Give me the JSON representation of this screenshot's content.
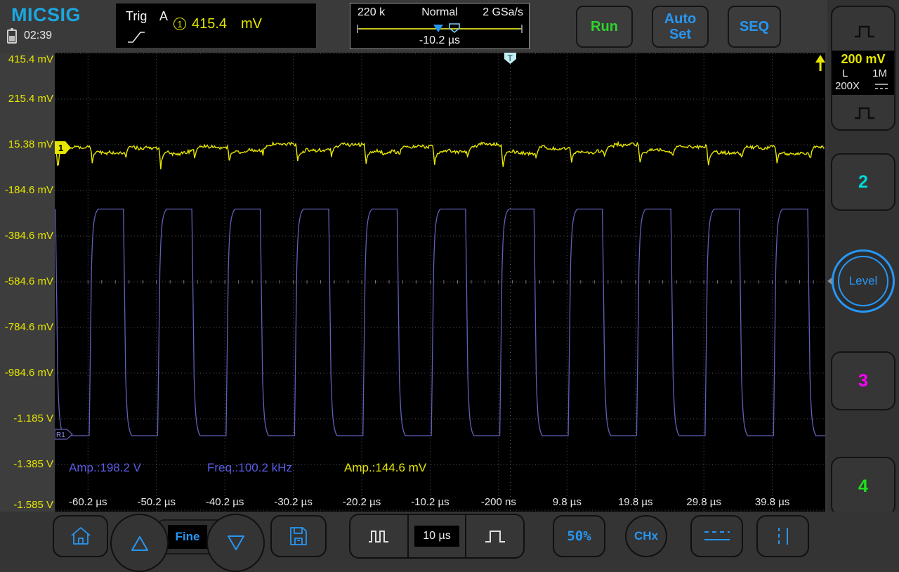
{
  "header": {
    "logo": "MICSIG",
    "clock": "02:39",
    "trig": {
      "title": "Trig",
      "mode": "A",
      "source": "1",
      "level": "415.4",
      "unit": "mV"
    },
    "acq": {
      "depth": "220 k",
      "mode": "Normal",
      "rate": "2 GSa/s",
      "delay": "-10.2 µs"
    },
    "buttons": {
      "run": "Run",
      "autoset": "Auto Set",
      "seq": "SEQ"
    }
  },
  "sidebar": {
    "channel_info": {
      "scale": "200 mV",
      "coupling": "L",
      "impedance": "1M",
      "probe": "200X"
    },
    "ch2": "2",
    "knob": "Level",
    "ch3": "3",
    "ch4": "4"
  },
  "plot": {
    "voltage_labels": [
      "415.4 mV",
      "215.4 mV",
      "15.38 mV",
      "-184.6 mV",
      "-384.6 mV",
      "-584.6 mV",
      "-784.6 mV",
      "-984.6 mV",
      "-1.185 V",
      "-1.385 V",
      "-1.585 V"
    ],
    "time_labels": [
      "-60.2 µs",
      "-50.2 µs",
      "-40.2 µs",
      "-30.2 µs",
      "-20.2 µs",
      "-10.2 µs",
      "-200 ns",
      "9.8 µs",
      "19.8 µs",
      "29.8 µs",
      "39.8 µs"
    ],
    "measurements": [
      {
        "text": "Amp.:198.2 V",
        "color": "#5c5ce8",
        "x": 20
      },
      {
        "text": "Freq.:100.2 kHz",
        "color": "#5c5ce8",
        "x": 217
      },
      {
        "text": "Amp.:144.6 mV",
        "color": "#e6e600",
        "x": 412
      }
    ],
    "markers": {
      "ch1": "1",
      "ref": "R1",
      "trig": "T"
    }
  },
  "toolbar": {
    "fine": "Fine",
    "timebase": "10 µs",
    "percent": "50%",
    "chx": "CHx"
  },
  "chart_data": {
    "type": "line",
    "title": "Oscilloscope traces",
    "x_axis": {
      "label": "time",
      "range": [
        "-60.2 µs",
        "39.8 µs"
      ],
      "per_division": "10 µs"
    },
    "series": [
      {
        "name": "CH1",
        "color": "#e6e600",
        "shape": "noisy ripple with switching spikes",
        "vertical_scale": "200 mV/div",
        "baseline": "15.38 mV",
        "measured_amplitude": "144.6 mV",
        "measured_frequency": "100.2 kHz"
      },
      {
        "name": "R1",
        "color": "#6060ba",
        "shape": "square wave, rounded rise/fall",
        "duty_cycle": 0.5,
        "measured_amplitude": "198.2 V",
        "measured_frequency": "100.2 kHz"
      }
    ]
  },
  "colors": {
    "accent_blue": "#2796f3",
    "yellow": "#e6e600",
    "green": "#2ed32e",
    "magenta": "#ff00ff",
    "cyan": "#00d8d8",
    "wave_blue": "#6060ba",
    "meas_blue": "#5c5ce8",
    "grid": "#585858"
  }
}
